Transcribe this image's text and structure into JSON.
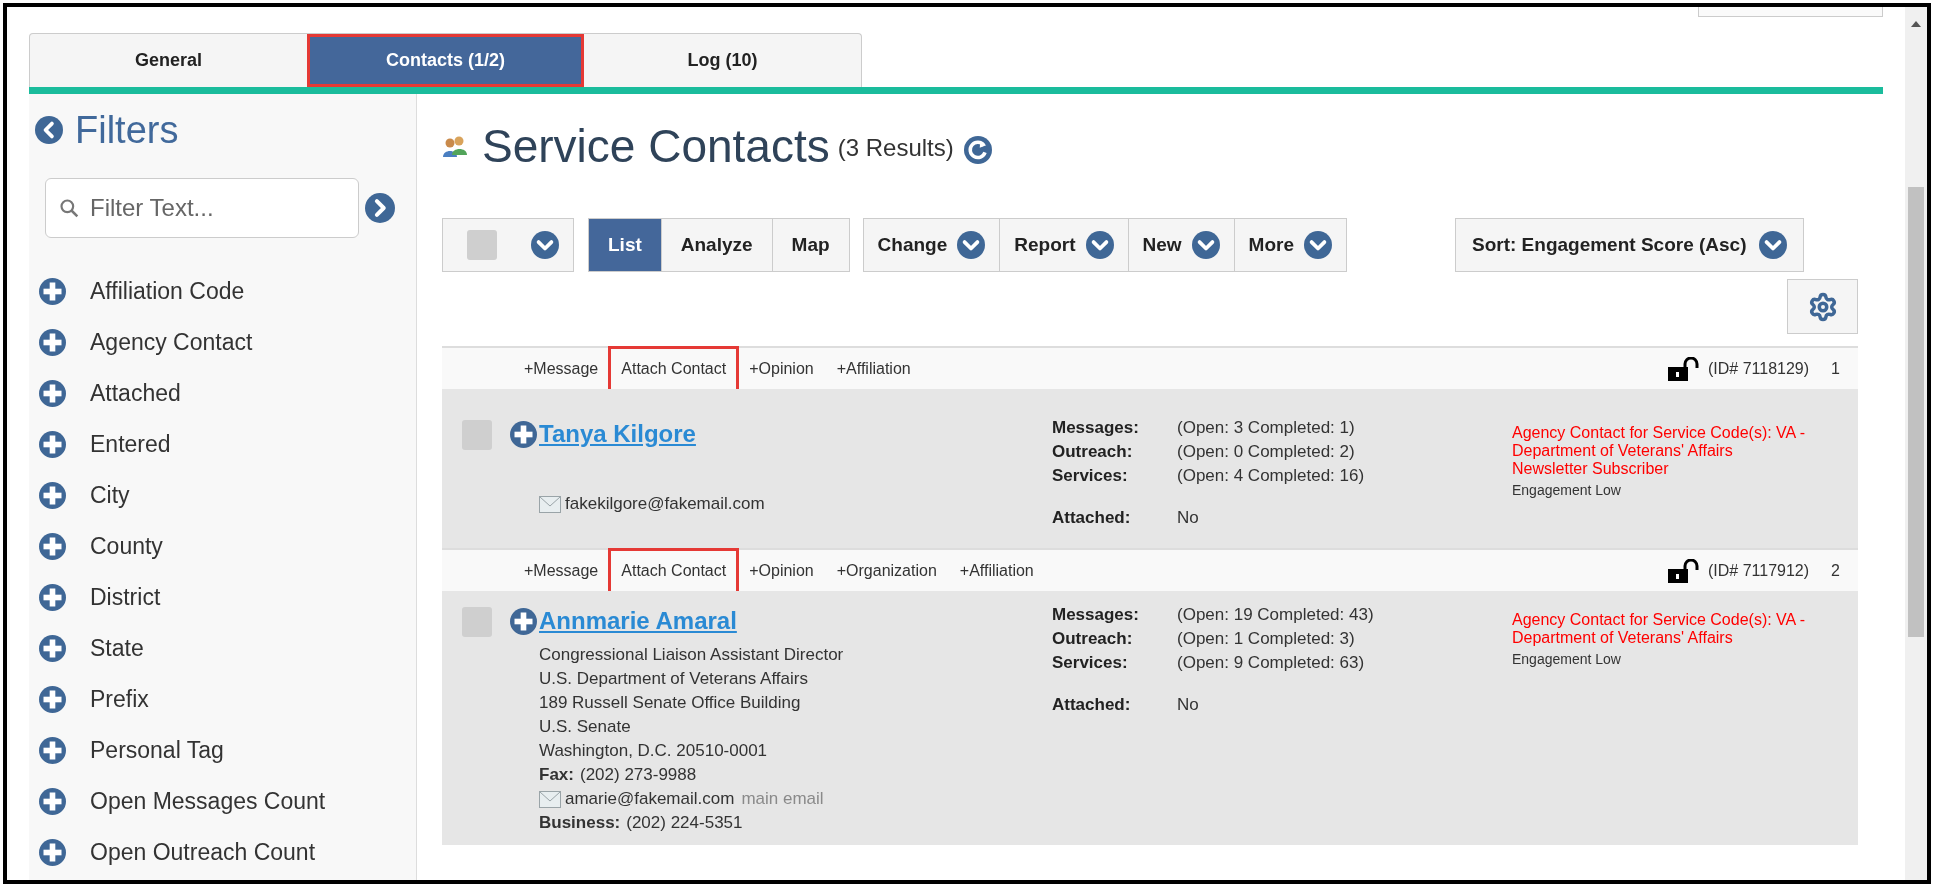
{
  "tabs": [
    {
      "label": "General",
      "selected": false,
      "highlighted": false
    },
    {
      "label": "Contacts (1/2)",
      "selected": true,
      "highlighted": true
    },
    {
      "label": "Log (10)",
      "selected": false,
      "highlighted": false
    }
  ],
  "filters": {
    "title": "Filters",
    "search_placeholder": "Filter Text...",
    "items": [
      "Affiliation Code",
      "Agency Contact",
      "Attached",
      "Entered",
      "City",
      "County",
      "District",
      "State",
      "Prefix",
      "Personal Tag",
      "Open Messages Count",
      "Open Outreach Count"
    ]
  },
  "main": {
    "title": "Service Contacts",
    "result_count": "(3 Results)"
  },
  "toolbar": {
    "select_all_checked": false,
    "views": [
      {
        "label": "List",
        "selected": true
      },
      {
        "label": "Analyze",
        "selected": false
      },
      {
        "label": "Map",
        "selected": false
      }
    ],
    "menus": [
      "Change",
      "Report",
      "New",
      "More"
    ],
    "sort": "Sort: Engagement Score (Asc)"
  },
  "records": [
    {
      "checked": false,
      "locked": false,
      "id": "(ID# 7118129)",
      "index": "1",
      "name": "Tanya Kilgore",
      "actions": [
        {
          "label": "+Message",
          "highlighted": false
        },
        {
          "label": "Attach Contact",
          "highlighted": true
        },
        {
          "label": "+Opinion",
          "highlighted": false
        },
        {
          "label": "+Affiliation",
          "highlighted": false
        }
      ],
      "details": [
        {
          "kind": "email",
          "value": "fakekilgore@fakemail.com"
        }
      ],
      "stats": [
        {
          "label": "Messages:",
          "value": "(Open: 3 Completed: 1)"
        },
        {
          "label": "Outreach:",
          "value": "(Open: 0 Completed: 2)"
        },
        {
          "label": "Services:",
          "value": "(Open: 4 Completed: 16)"
        }
      ],
      "attached": {
        "label": "Attached:",
        "value": "No"
      },
      "tags": [
        "Agency Contact for Service Code(s): VA - Department of Veterans' Affairs",
        "Newsletter Subscriber"
      ],
      "engagement": "Engagement Low"
    },
    {
      "checked": false,
      "locked": false,
      "id": "(ID# 7117912)",
      "index": "2",
      "name": "Annmarie Amaral",
      "actions": [
        {
          "label": "+Message",
          "highlighted": false
        },
        {
          "label": "Attach Contact",
          "highlighted": true
        },
        {
          "label": "+Opinion",
          "highlighted": false
        },
        {
          "label": "+Organization",
          "highlighted": false
        },
        {
          "label": "+Affiliation",
          "highlighted": false
        }
      ],
      "details": [
        {
          "kind": "text",
          "value": "Congressional Liaison Assistant Director"
        },
        {
          "kind": "text",
          "value": "U.S. Department of Veterans Affairs"
        },
        {
          "kind": "text",
          "value": "189 Russell Senate Office Building"
        },
        {
          "kind": "text",
          "value": "U.S. Senate"
        },
        {
          "kind": "text",
          "value": "Washington, D.C. 20510-0001"
        },
        {
          "kind": "field",
          "label": "Fax:",
          "value": "(202) 273-9988"
        },
        {
          "kind": "email",
          "value": "amarie@fakemail.com",
          "note": "main email"
        },
        {
          "kind": "field",
          "label": "Business:",
          "value": "(202) 224-5351"
        }
      ],
      "stats": [
        {
          "label": "Messages:",
          "value": "(Open: 19 Completed: 43)"
        },
        {
          "label": "Outreach:",
          "value": "(Open: 1 Completed: 3)"
        },
        {
          "label": "Services:",
          "value": "(Open: 9 Completed: 63)"
        }
      ],
      "attached": {
        "label": "Attached:",
        "value": "No"
      },
      "tags": [
        "Agency Contact for Service Code(s): VA - Department of Veterans' Affairs"
      ],
      "engagement": "Engagement Low"
    }
  ]
}
